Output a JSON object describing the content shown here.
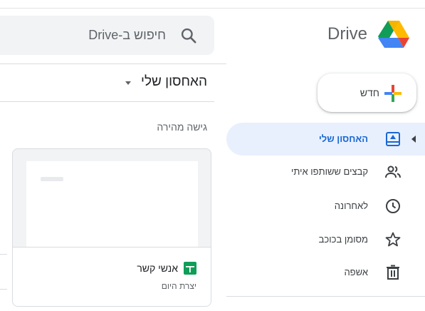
{
  "header": {
    "logo_text": "Drive",
    "logo_icon": "google-drive-logo",
    "search": {
      "placeholder": "חיפוש ב-Drive",
      "icon": "search-icon"
    }
  },
  "sidebar": {
    "new_button": {
      "label": "חדש",
      "icon": "plus-icon"
    },
    "items": [
      {
        "label": "האחסון שלי",
        "icon": "my-drive-icon",
        "active": true
      },
      {
        "label": "קבצים ששותפו איתי",
        "icon": "people-icon",
        "active": false
      },
      {
        "label": "לאחרונה",
        "icon": "clock-icon",
        "active": false
      },
      {
        "label": "מסומן בכוכב",
        "icon": "star-icon",
        "active": false
      },
      {
        "label": "אשפה",
        "icon": "trash-icon",
        "active": false
      }
    ]
  },
  "main": {
    "title": "האחסון שלי",
    "title_icon": "dropdown-caret-icon",
    "quick_access": {
      "label": "גישה מהירה",
      "files": [
        {
          "name": "אנשי קשר",
          "meta": "יצרת היום",
          "icon": "sheets-icon"
        }
      ]
    }
  },
  "colors": {
    "accent": "#1967d2",
    "active_bg": "#e8f0fe",
    "search_bg": "#f1f3f4",
    "sheets_green": "#0f9d58"
  }
}
